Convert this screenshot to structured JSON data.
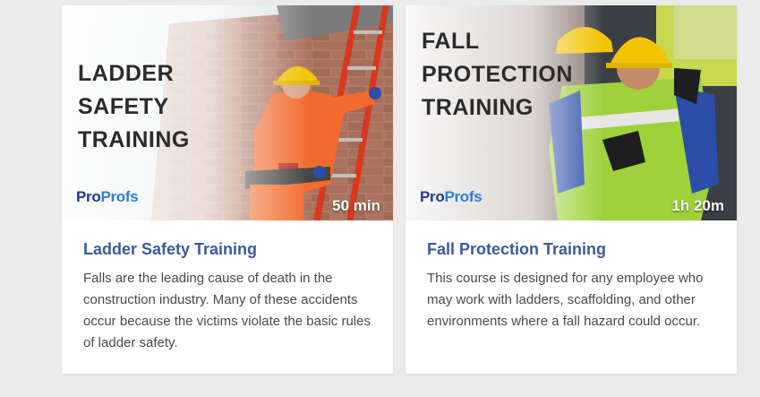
{
  "courses": [
    {
      "thumb_title": "LADDER\nSAFETY\nTRAINING",
      "logo": {
        "pro": "Pro",
        "profs": "Profs"
      },
      "duration": "50 min",
      "title": "Ladder Safety Training",
      "description": "Falls are the leading cause of death in the construction industry. Many of these accidents occur because the victims violate the basic rules of ladder safety."
    },
    {
      "thumb_title": "FALL\nPROTECTION\nTRAINING",
      "logo": {
        "pro": "Pro",
        "profs": "Profs"
      },
      "duration": "1h 20m",
      "title": "Fall Protection Training",
      "description": "This course is designed for any employee who may work with ladders, scaffolding, and other environments where a fall hazard could occur."
    }
  ],
  "colors": {
    "page_background": "#ebebeb",
    "card_background": "#ffffff",
    "title_link": "#3b5a9a",
    "description_text": "#4a4a4a",
    "logo_pro": "#1e3a8a",
    "logo_profs": "#2e7fd6"
  }
}
